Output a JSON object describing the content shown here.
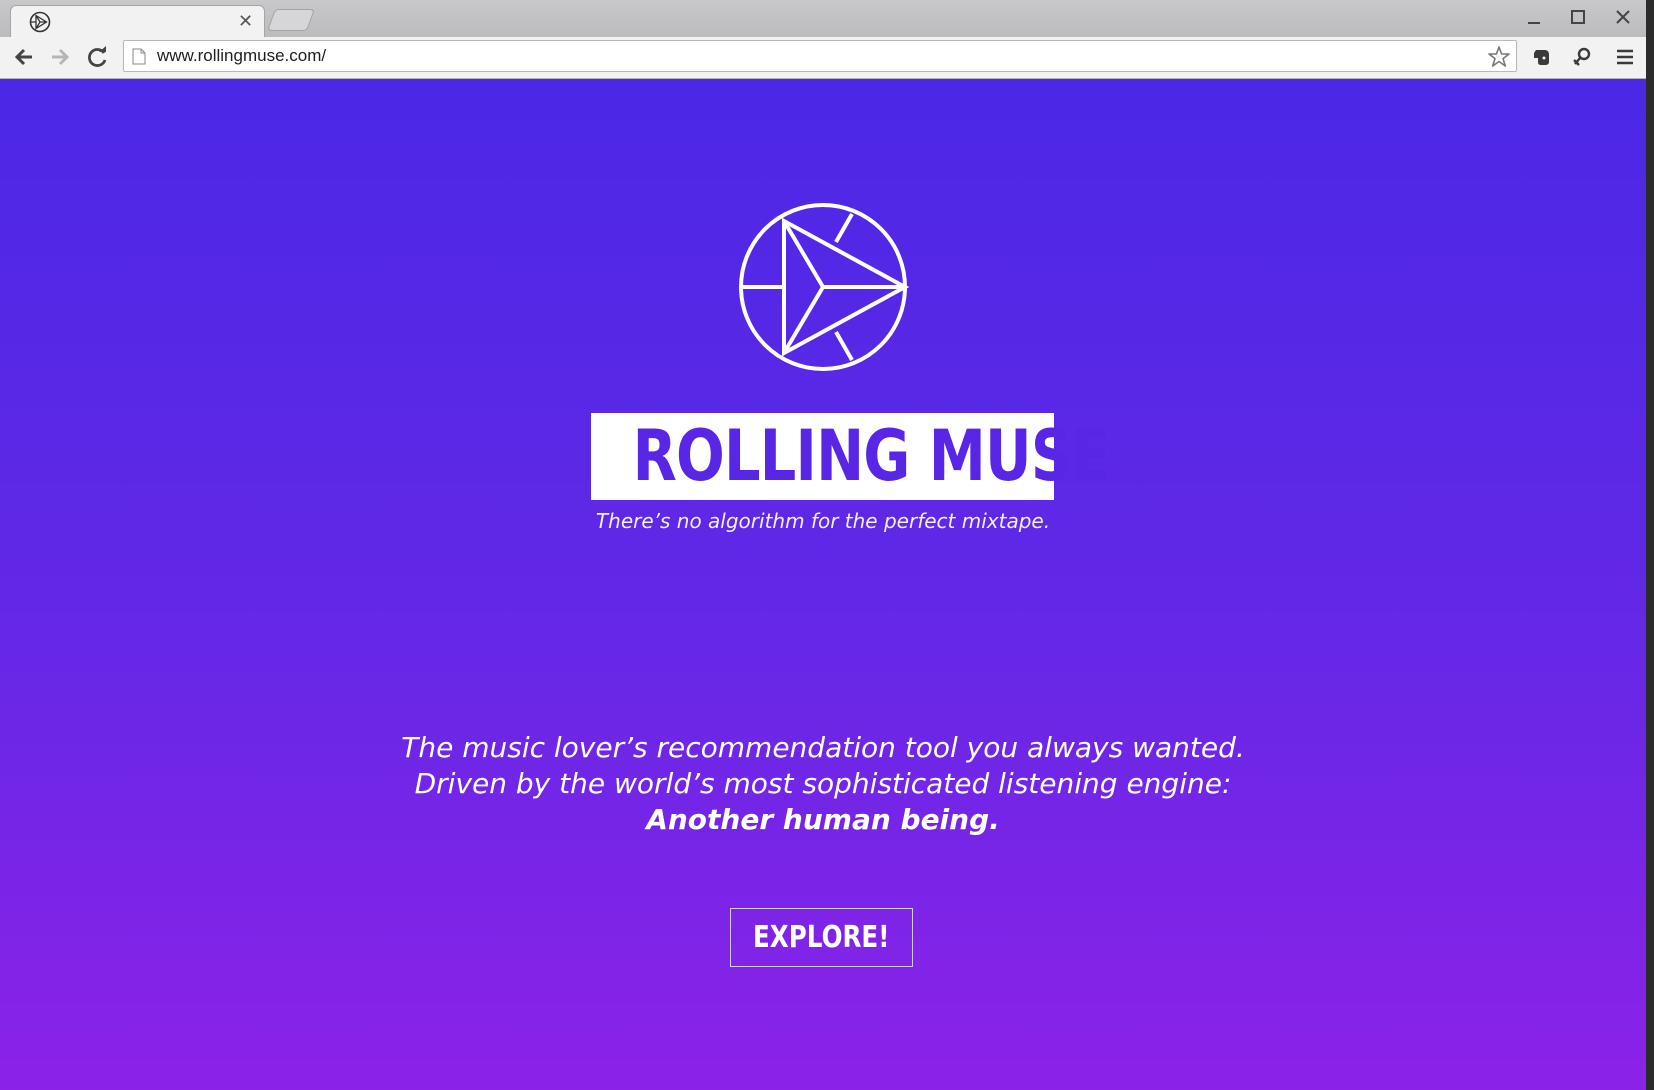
{
  "browser": {
    "tab": {
      "title": "",
      "favicon": "rolling-muse-logo"
    },
    "url": "www.rollingmuse.com/"
  },
  "hero": {
    "title": "ROLLING MUSE",
    "tagline": "There’s no algorithm for the perfect mixtape.",
    "pitch_line1": "The music lover’s recommendation tool you always wanted.",
    "pitch_line2": "Driven by the world’s most sophisticated listening engine:",
    "pitch_line3": "Another human being.",
    "cta_label": "EXPLORE!"
  },
  "colors": {
    "gradient_top": "#4b28e6",
    "gradient_bottom": "#8c22e8",
    "title_text": "#5a26e6",
    "white": "#ffffff"
  }
}
